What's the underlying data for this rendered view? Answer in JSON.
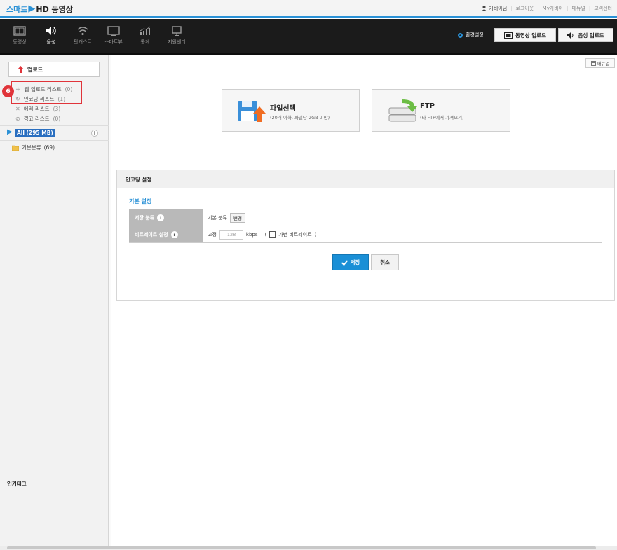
{
  "app": {
    "logo_part1": "스마트",
    "logo_part2": "HD 동영상",
    "top_links": {
      "user": "가비아님",
      "logout": "로그아웃",
      "my_gabia": "My가비아",
      "manual": "매뉴얼",
      "support": "고객센터"
    }
  },
  "nav": {
    "items": [
      {
        "label": "동영상",
        "icon": "film-icon",
        "active": false
      },
      {
        "label": "음성",
        "icon": "speaker-icon",
        "active": true
      },
      {
        "label": "팟캐스트",
        "icon": "wifi-icon",
        "active": false
      },
      {
        "label": "스마트뷰",
        "icon": "screen-icon",
        "active": false
      },
      {
        "label": "통계",
        "icon": "chart-icon",
        "active": false
      },
      {
        "label": "지원센터",
        "icon": "monitor-icon",
        "active": false
      }
    ],
    "settings_label": "환경설정",
    "upload_video_label": "동영상 업로드",
    "upload_audio_label": "음성 업로드"
  },
  "sidebar": {
    "upload_label": "업로드",
    "step_number": "6",
    "lists": [
      {
        "label": "웹 업로드 리스트",
        "count": "(0)",
        "icon": "plus-icon"
      },
      {
        "label": "인코딩 리스트",
        "count": "(1)",
        "icon": "refresh-icon"
      },
      {
        "label": "에러 리스트",
        "count": "(3)",
        "icon": "x-icon"
      },
      {
        "label": "경고 리스트",
        "count": "(0)",
        "icon": "warning-icon"
      }
    ],
    "all_label": "All (295 MB)",
    "folder_label": "기본분류",
    "folder_count": "(69)",
    "tags_title": "인기태그"
  },
  "main": {
    "manual_label": "매뉴얼",
    "file_select": {
      "title": "파일선택",
      "desc": "(20개 이하, 파일당 2GB 미만)"
    },
    "ftp": {
      "title": "FTP",
      "desc": "(타 FTP에서 가져오기)"
    },
    "settings": {
      "header": "인코딩 설정",
      "basic_title": "기본 설정",
      "rows": {
        "category_label": "저장 분류",
        "category_value": "기본 분류",
        "category_change": "변경",
        "bitrate_label": "비트레이트 설정",
        "bitrate_fixed": "고정",
        "bitrate_value": "128",
        "bitrate_unit": "kbps",
        "variable_label": "가변 비트레이트"
      },
      "save_label": "저장",
      "cancel_label": "취소"
    }
  },
  "colors": {
    "accent": "#2a91d6",
    "nav_bg": "#1b1b1b",
    "highlight": "#e0343a"
  }
}
